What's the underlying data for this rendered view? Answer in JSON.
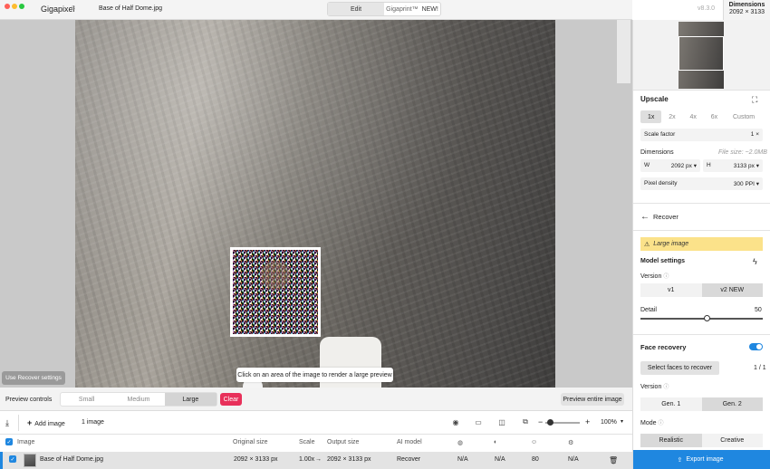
{
  "titlebar": {
    "app_name": "Gigapixel",
    "app_version": "8",
    "file_name": "Base of Half Dome.jpg",
    "tab_edit": "Edit",
    "tab_gigaprint": "Gigaprint™",
    "tab_gigaprint_badge": "NEW!",
    "version": "v8.3.0",
    "dimensions_title": "Dimensions",
    "dimensions_value": "2092 × 3133"
  },
  "canvas": {
    "use_recover_settings": "Use Recover settings",
    "preview_hint": "Click on an area of the image to render a large preview"
  },
  "preview_controls": {
    "label": "Preview controls",
    "sizes": [
      "Small",
      "Medium",
      "Large"
    ],
    "selected_size": "Large",
    "clear": "Clear",
    "preview_entire": "Preview entire image"
  },
  "toolbar": {
    "add_image": "Add image",
    "image_count": "1 image",
    "zoom_minus": "−",
    "zoom_plus": "+",
    "zoom": "100%"
  },
  "table": {
    "headers": {
      "image": "Image",
      "original_size": "Original size",
      "scale": "Scale",
      "output_size": "Output size",
      "ai_model": "AI model"
    },
    "rows": [
      {
        "name": "Base of Half Dome.jpg",
        "original_size": "2092 × 3133 px",
        "scale": "1.00x",
        "arrow": "→",
        "output_size": "2092 × 3133 px",
        "ai_model": "Recover",
        "c1": "N/A",
        "c2": "N/A",
        "c3": "80",
        "c4": "N/A"
      }
    ]
  },
  "panel": {
    "upscale_title": "Upscale",
    "scale_options": [
      "1x",
      "2x",
      "4x",
      "6x",
      "Custom"
    ],
    "selected_scale": "1x",
    "scale_factor_label": "Scale factor",
    "scale_factor_value": "1",
    "scale_factor_unit": "×",
    "dimensions_label": "Dimensions",
    "file_size": "File size: ~2.0MB",
    "width_label": "W",
    "width_value": "2092",
    "width_unit": "px",
    "height_label": "H",
    "height_value": "3133",
    "height_unit": "px",
    "pixel_density_label": "Pixel density",
    "pixel_density_value": "300",
    "pixel_density_unit": "PPI",
    "recover_title": "Recover",
    "warning": "Large image",
    "model_settings": "Model settings",
    "version_label": "Version",
    "version_options": [
      "v1",
      "v2"
    ],
    "version_new_badge": "NEW",
    "selected_version": "v2",
    "detail_label": "Detail",
    "detail_value": "50",
    "face_recovery_title": "Face recovery",
    "face_recovery_enabled": true,
    "select_faces": "Select faces to recover",
    "faces_count": "1 / 1",
    "face_version_label": "Version",
    "gen_options": [
      "Gen. 1",
      "Gen. 2"
    ],
    "selected_gen": "Gen. 2",
    "mode_label": "Mode",
    "mode_options": [
      "Realistic",
      "Creative"
    ],
    "selected_mode": "Realistic",
    "export": "Export image"
  },
  "colors": {
    "accent": "#1f87e0",
    "clear_button": "#e8305a",
    "warning_bg": "#fbe28a"
  }
}
